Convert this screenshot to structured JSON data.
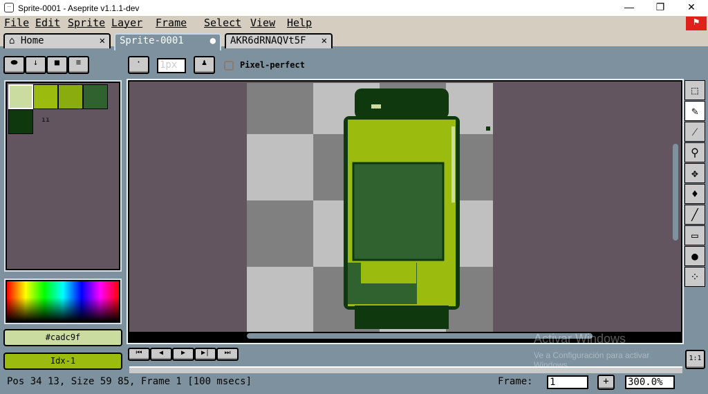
{
  "window": {
    "title": "Sprite-0001 - Aseprite v1.1.1-dev",
    "minimize": "—",
    "maximize": "❐",
    "close": "✕"
  },
  "menu": [
    "File",
    "Edit",
    "Sprite",
    "Layer",
    "Frame",
    "Select",
    "View",
    "Help"
  ],
  "tabs": [
    {
      "label": "Home",
      "close": "✕",
      "icon": "home-icon"
    },
    {
      "label": "Sprite-0001",
      "modified": "●"
    },
    {
      "label": "AKR6dRNAQVt5F",
      "close": "✕"
    }
  ],
  "toolbar": {
    "brush_size": "1px",
    "pixel_perfect_label": "Pixel-perfect",
    "pixel_perfect": false
  },
  "palette": {
    "colors": [
      "#cadc9f",
      "#9bbc0f",
      "#8bac0f",
      "#306230",
      "#0f380f"
    ],
    "marker": "ıı"
  },
  "color_bar": {
    "fg_label": "#cadc9f",
    "fg_color": "#cadc9f",
    "bg_label": "Idx-1",
    "bg_color": "#9bbc0f"
  },
  "status": {
    "text": "Pos 34 13, Size 59 85, Frame 1 [100 msecs]",
    "frame_label": "Frame:",
    "frame_value": "1",
    "add_frame": "+",
    "zoom": "300.0%",
    "one_to_one": "1:1"
  },
  "watermark": {
    "title": "Activar Windows",
    "line": "Ve a Configuración para activar Windows."
  }
}
